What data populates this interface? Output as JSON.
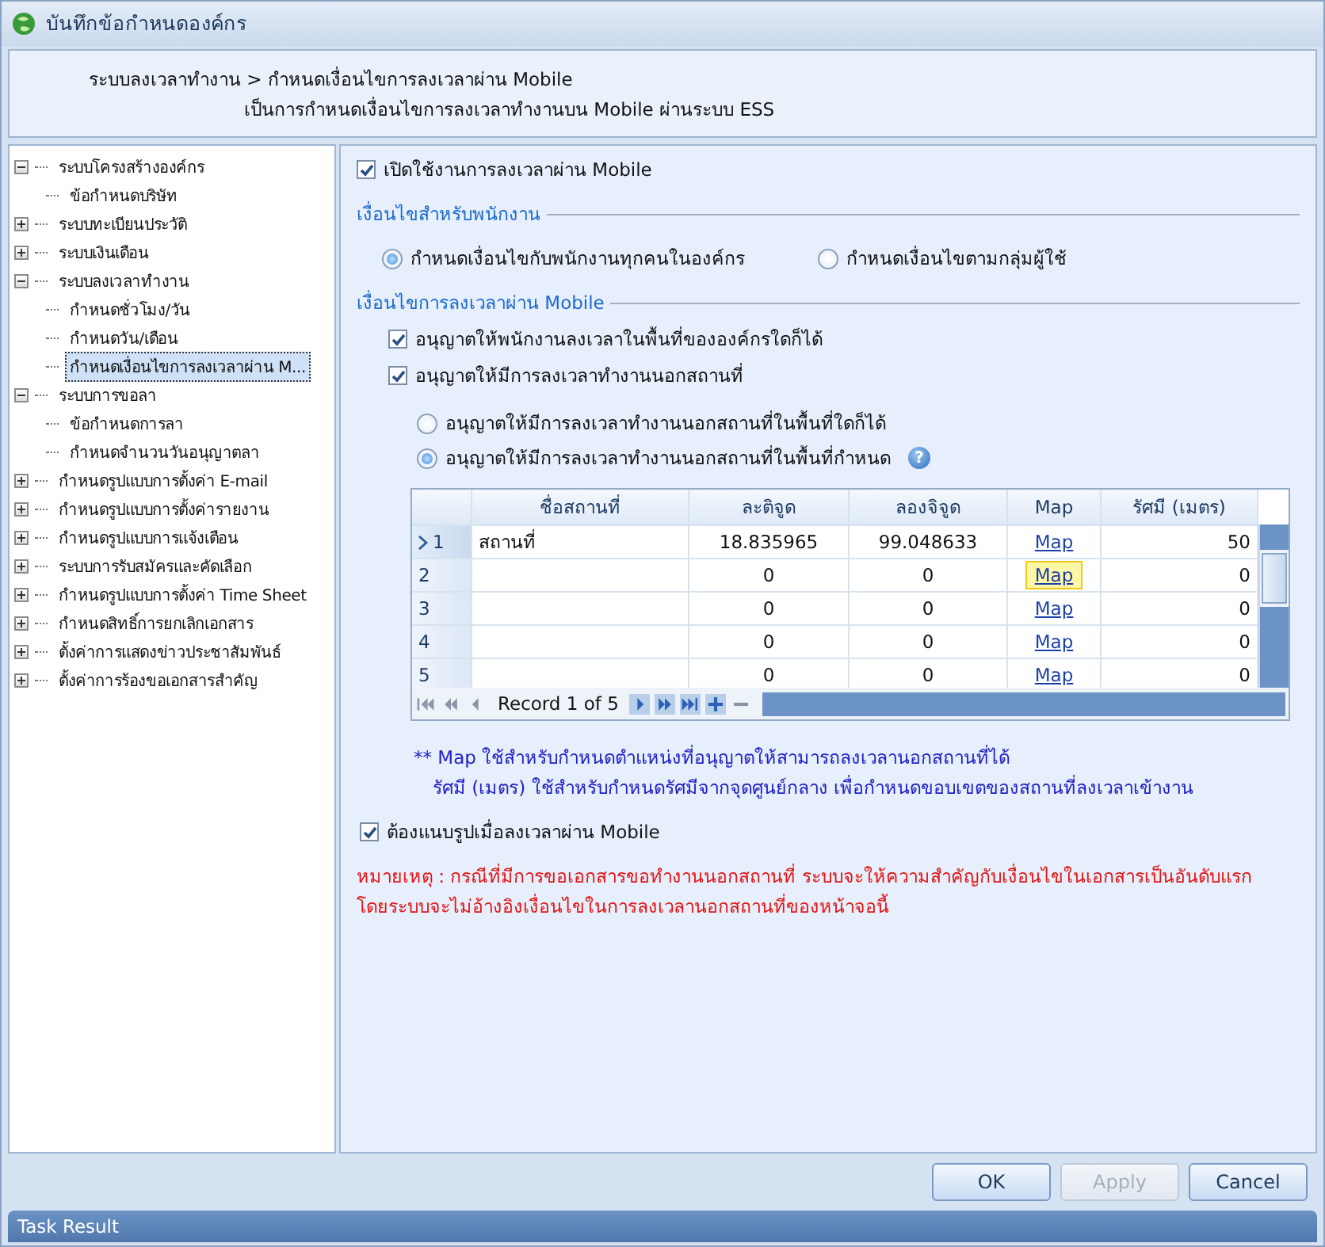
{
  "window": {
    "title": "บันทึกข้อกำหนดองค์กร"
  },
  "header": {
    "breadcrumb": "ระบบลงเวลาทำงาน > กำหนดเงื่อนไขการลงเวลาผ่าน Mobile",
    "description": "เป็นการกำหนดเงื่อนไขการลงเวลาทำงานบน Mobile ผ่านระบบ ESS"
  },
  "tree": [
    {
      "label": "ระบบโครงสร้างองค์กร",
      "expanded": true,
      "selected": false,
      "children": [
        {
          "label": "ข้อกำหนดบริษัท",
          "selected": false
        }
      ]
    },
    {
      "label": "ระบบทะเบียนประวัติ",
      "expanded": false,
      "selected": false
    },
    {
      "label": "ระบบเงินเดือน",
      "expanded": false,
      "selected": false
    },
    {
      "label": "ระบบลงเวลาทำงาน",
      "expanded": true,
      "selected": false,
      "children": [
        {
          "label": "กำหนดชั่วโมง/วัน",
          "selected": false
        },
        {
          "label": "กำหนดวัน/เดือน",
          "selected": false
        },
        {
          "label": "กำหนดเงื่อนไขการลงเวลาผ่าน M...",
          "selected": true
        }
      ]
    },
    {
      "label": "ระบบการขอลา",
      "expanded": true,
      "selected": false,
      "children": [
        {
          "label": "ข้อกำหนดการลา",
          "selected": false
        },
        {
          "label": "กำหนดจำนวนวันอนุญาตลา",
          "selected": false
        }
      ]
    },
    {
      "label": "กำหนดรูปแบบการตั้งค่า E-mail",
      "expanded": false,
      "selected": false
    },
    {
      "label": "กำหนดรูปแบบการตั้งค่ารายงาน",
      "expanded": false,
      "selected": false
    },
    {
      "label": "กำหนดรูปแบบการแจ้งเตือน",
      "expanded": false,
      "selected": false
    },
    {
      "label": "ระบบการรับสมัครและคัดเลือก",
      "expanded": false,
      "selected": false
    },
    {
      "label": "กำหนดรูปแบบการตั้งค่า Time Sheet",
      "expanded": false,
      "selected": false
    },
    {
      "label": "กำหนดสิทธิ์การยกเลิกเอกสาร",
      "expanded": false,
      "selected": false
    },
    {
      "label": "ตั้งค่าการแสดงข่าวประชาสัมพันธ์",
      "expanded": false,
      "selected": false
    },
    {
      "label": "ตั้งค่าการร้องขอเอกสารสำคัญ",
      "expanded": false,
      "selected": false
    }
  ],
  "enable_mobile": {
    "label": "เปิดใช้งานการลงเวลาผ่าน Mobile",
    "checked": true
  },
  "employee_conditions": {
    "title": "เงื่อนไขสำหรับพนักงาน",
    "options": [
      {
        "label": "กำหนดเงื่อนไขกับพนักงานทุกคนในองค์กร",
        "selected": true
      },
      {
        "label": "กำหนดเงื่อนไขตามกลุ่มผู้ใช้",
        "selected": false
      }
    ]
  },
  "mobile_conditions": {
    "title": "เงื่อนไขการลงเวลาผ่าน Mobile",
    "checks": [
      {
        "label": "อนุญาตให้พนักงานลงเวลาในพื้นที่ขององค์กรใดก็ได้",
        "checked": true
      },
      {
        "label": "อนุญาตให้มีการลงเวลาทำงานนอกสถานที่",
        "checked": true
      }
    ],
    "offsite_options": [
      {
        "label": "อนุญาตให้มีการลงเวลาทำงานนอกสถานที่ในพื้นที่ใดก็ได้",
        "selected": false
      },
      {
        "label": "อนุญาตให้มีการลงเวลาทำงานนอกสถานที่ในพื้นที่กำหนด",
        "selected": true,
        "help": "?"
      }
    ]
  },
  "locations_table": {
    "columns": [
      "ชื่อสถานที่",
      "ละติจูด",
      "ลองจิจูด",
      "Map",
      "รัศมี (เมตร)"
    ],
    "rows": [
      {
        "number": "1",
        "current": true,
        "name": "สถานที่",
        "latitude": "18.835965",
        "longitude": "99.048633",
        "map": "Map",
        "map_focused": false,
        "radius": "50"
      },
      {
        "number": "2",
        "current": false,
        "name": "",
        "latitude": "0",
        "longitude": "0",
        "map": "Map",
        "map_focused": true,
        "radius": "0"
      },
      {
        "number": "3",
        "current": false,
        "name": "",
        "latitude": "0",
        "longitude": "0",
        "map": "Map",
        "map_focused": false,
        "radius": "0"
      },
      {
        "number": "4",
        "current": false,
        "name": "",
        "latitude": "0",
        "longitude": "0",
        "map": "Map",
        "map_focused": false,
        "radius": "0"
      },
      {
        "number": "5",
        "current": false,
        "name": "",
        "latitude": "0",
        "longitude": "0",
        "map": "Map",
        "map_focused": false,
        "radius": "0"
      }
    ],
    "navigator": {
      "record": "Record 1 of 5"
    }
  },
  "notes": [
    "** Map ใช้สำหรับกำหนดตำแหน่งที่อนุญาตให้สามารถลงเวลานอกสถานที่ได้",
    "รัศมี (เมตร) ใช้สำหรับกำหนดรัศมีจากจุดศูนย์กลาง เพื่อกำหนดขอบเขตของสถานที่ลงเวลาเข้างาน"
  ],
  "require_photo": {
    "label": "ต้องแนบรูปเมื่อลงเวลาผ่าน Mobile",
    "checked": true
  },
  "remark": [
    "หมายเหตุ : กรณีที่มีการขอเอกสารขอทำงานนอกสถานที่ ระบบจะให้ความสำคัญกับเงื่อนไขในเอกสารเป็นอันดับแรก",
    "โดยระบบจะไม่อ้างอิงเงื่อนไขในการลงเวลานอกสถานที่ของหน้าจอนี้"
  ],
  "buttons": [
    {
      "label": "OK",
      "disabled": false
    },
    {
      "label": "Apply",
      "disabled": true
    },
    {
      "label": "Cancel",
      "disabled": false
    }
  ],
  "task_bar": {
    "title": "Task Result"
  }
}
